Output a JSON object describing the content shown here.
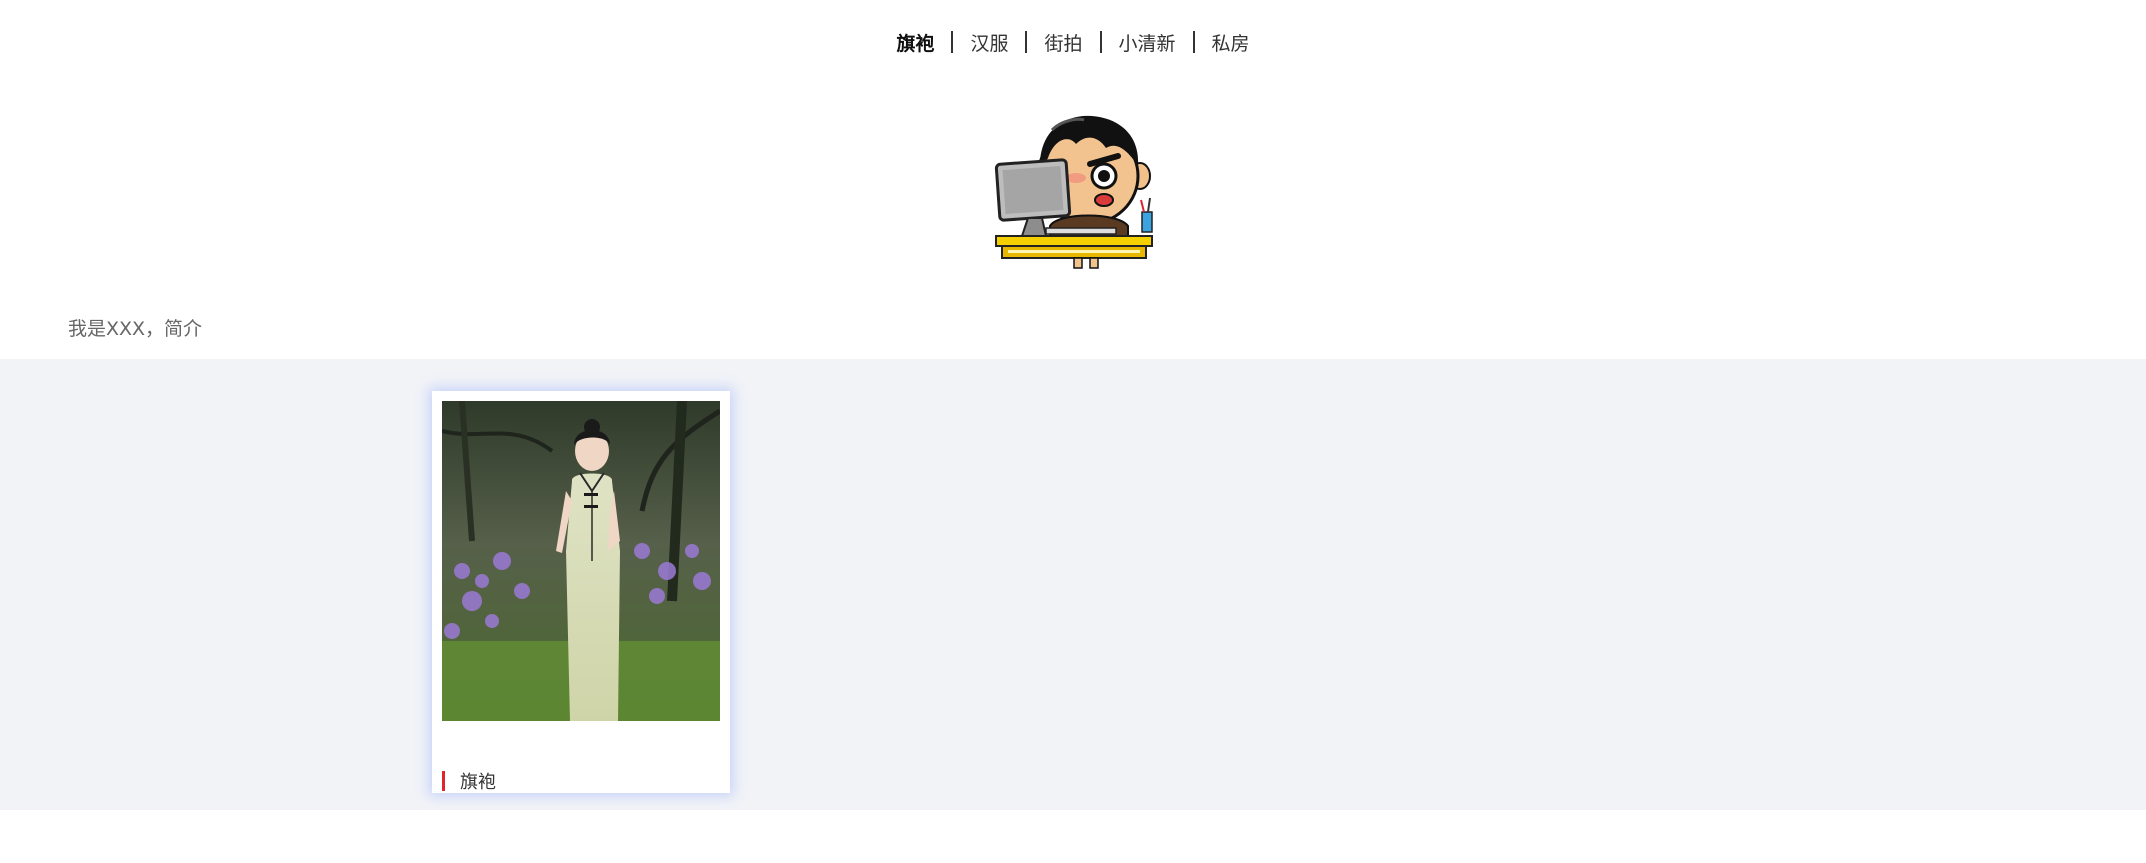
{
  "nav": {
    "items": [
      {
        "label": "旗袍",
        "active": true
      },
      {
        "label": "汉服",
        "active": false
      },
      {
        "label": "街拍",
        "active": false
      },
      {
        "label": "小清新",
        "active": false
      },
      {
        "label": "私房",
        "active": false
      }
    ]
  },
  "avatar": {
    "icon": "cartoon-boy-at-computer-icon"
  },
  "intro": {
    "text": "我是XXX，简介"
  },
  "gallery": {
    "cards": [
      {
        "title": "旗袍",
        "image": "qipao-photo",
        "accent_color": "#e0262a"
      }
    ]
  },
  "colors": {
    "gallery_bg": "#f1f3f7",
    "card_glow": "#7896ff",
    "caption_accent": "#e0262a"
  }
}
